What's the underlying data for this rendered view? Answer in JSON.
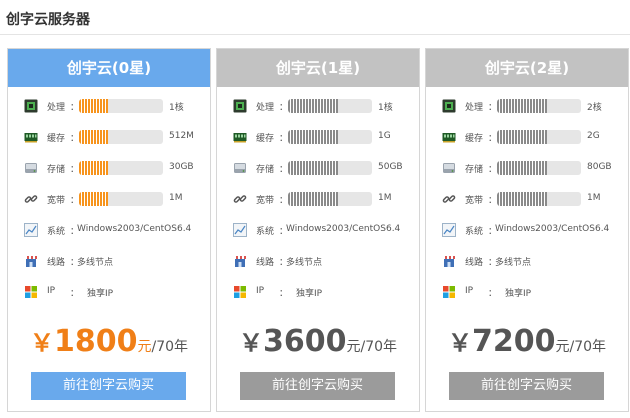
{
  "page_title": "创字云服务器",
  "colors": {
    "blue": "#69a9ec",
    "gray_head": "#c2c2c2",
    "gray_button": "#9b9b9b",
    "orange": "#f7941d",
    "price_orange": "#f07f17",
    "price_gray": "#555555",
    "bar_gray": "#8a8a8a"
  },
  "cards": [
    {
      "title": "创宇云(0星)",
      "specs": [
        {
          "icon": "cpu-icon",
          "label": "处理",
          "colon": "：",
          "fill": 0.35,
          "value": "1核"
        },
        {
          "icon": "memory-icon",
          "label": "缓存",
          "colon": "：",
          "fill": 0.35,
          "value": "512M"
        },
        {
          "icon": "disk-icon",
          "label": "存储",
          "colon": "：",
          "fill": 0.35,
          "value": "30GB"
        },
        {
          "icon": "link-icon",
          "label": "宽带",
          "colon": "：",
          "fill": 0.35,
          "value": "1M"
        }
      ],
      "info": [
        {
          "icon": "chart-icon",
          "label": "系统",
          "colon": "：",
          "value": "Windows2003/CentOS6.4"
        },
        {
          "icon": "store-icon",
          "label": "线路",
          "colon": "：",
          "value": "多线节点"
        },
        {
          "icon": "windows-icon",
          "label": "IP",
          "colon": "：",
          "value": "独享IP"
        }
      ],
      "price": {
        "currency": "￥",
        "amount": "1800",
        "unit": "元",
        "period": "/70年"
      },
      "button": "前往创字云购买"
    },
    {
      "title": "创宇云(1星)",
      "specs": [
        {
          "icon": "cpu-icon",
          "label": "处理",
          "colon": "：",
          "fill": 0.6,
          "value": "1核"
        },
        {
          "icon": "memory-icon",
          "label": "缓存",
          "colon": "：",
          "fill": 0.6,
          "value": "1G"
        },
        {
          "icon": "disk-icon",
          "label": "存储",
          "colon": "：",
          "fill": 0.6,
          "value": "50GB"
        },
        {
          "icon": "link-icon",
          "label": "宽带",
          "colon": "：",
          "fill": 0.6,
          "value": "1M"
        }
      ],
      "info": [
        {
          "icon": "chart-icon",
          "label": "系统",
          "colon": "：",
          "value": "Windows2003/CentOS6.4"
        },
        {
          "icon": "store-icon",
          "label": "线路",
          "colon": "：",
          "value": "多线节点"
        },
        {
          "icon": "windows-icon",
          "label": "IP",
          "colon": "：",
          "value": "独享IP"
        }
      ],
      "price": {
        "currency": "￥",
        "amount": "3600",
        "unit": "元",
        "period": "/70年"
      },
      "button": "前往创字云购买"
    },
    {
      "title": "创宇云(2星)",
      "specs": [
        {
          "icon": "cpu-icon",
          "label": "处理",
          "colon": "：",
          "fill": 0.6,
          "value": "2核"
        },
        {
          "icon": "memory-icon",
          "label": "缓存",
          "colon": "：",
          "fill": 0.6,
          "value": "2G"
        },
        {
          "icon": "disk-icon",
          "label": "存储",
          "colon": "：",
          "fill": 0.6,
          "value": "80GB"
        },
        {
          "icon": "link-icon",
          "label": "宽带",
          "colon": "：",
          "fill": 0.6,
          "value": "1M"
        }
      ],
      "info": [
        {
          "icon": "chart-icon",
          "label": "系统",
          "colon": "：",
          "value": "Windows2003/CentOS6.4"
        },
        {
          "icon": "store-icon",
          "label": "线路",
          "colon": "：",
          "value": "多线节点"
        },
        {
          "icon": "windows-icon",
          "label": "IP",
          "colon": "：",
          "value": "独享IP"
        }
      ],
      "price": {
        "currency": "￥",
        "amount": "7200",
        "unit": "元",
        "period": "/70年"
      },
      "button": "前往创字云购买"
    }
  ]
}
